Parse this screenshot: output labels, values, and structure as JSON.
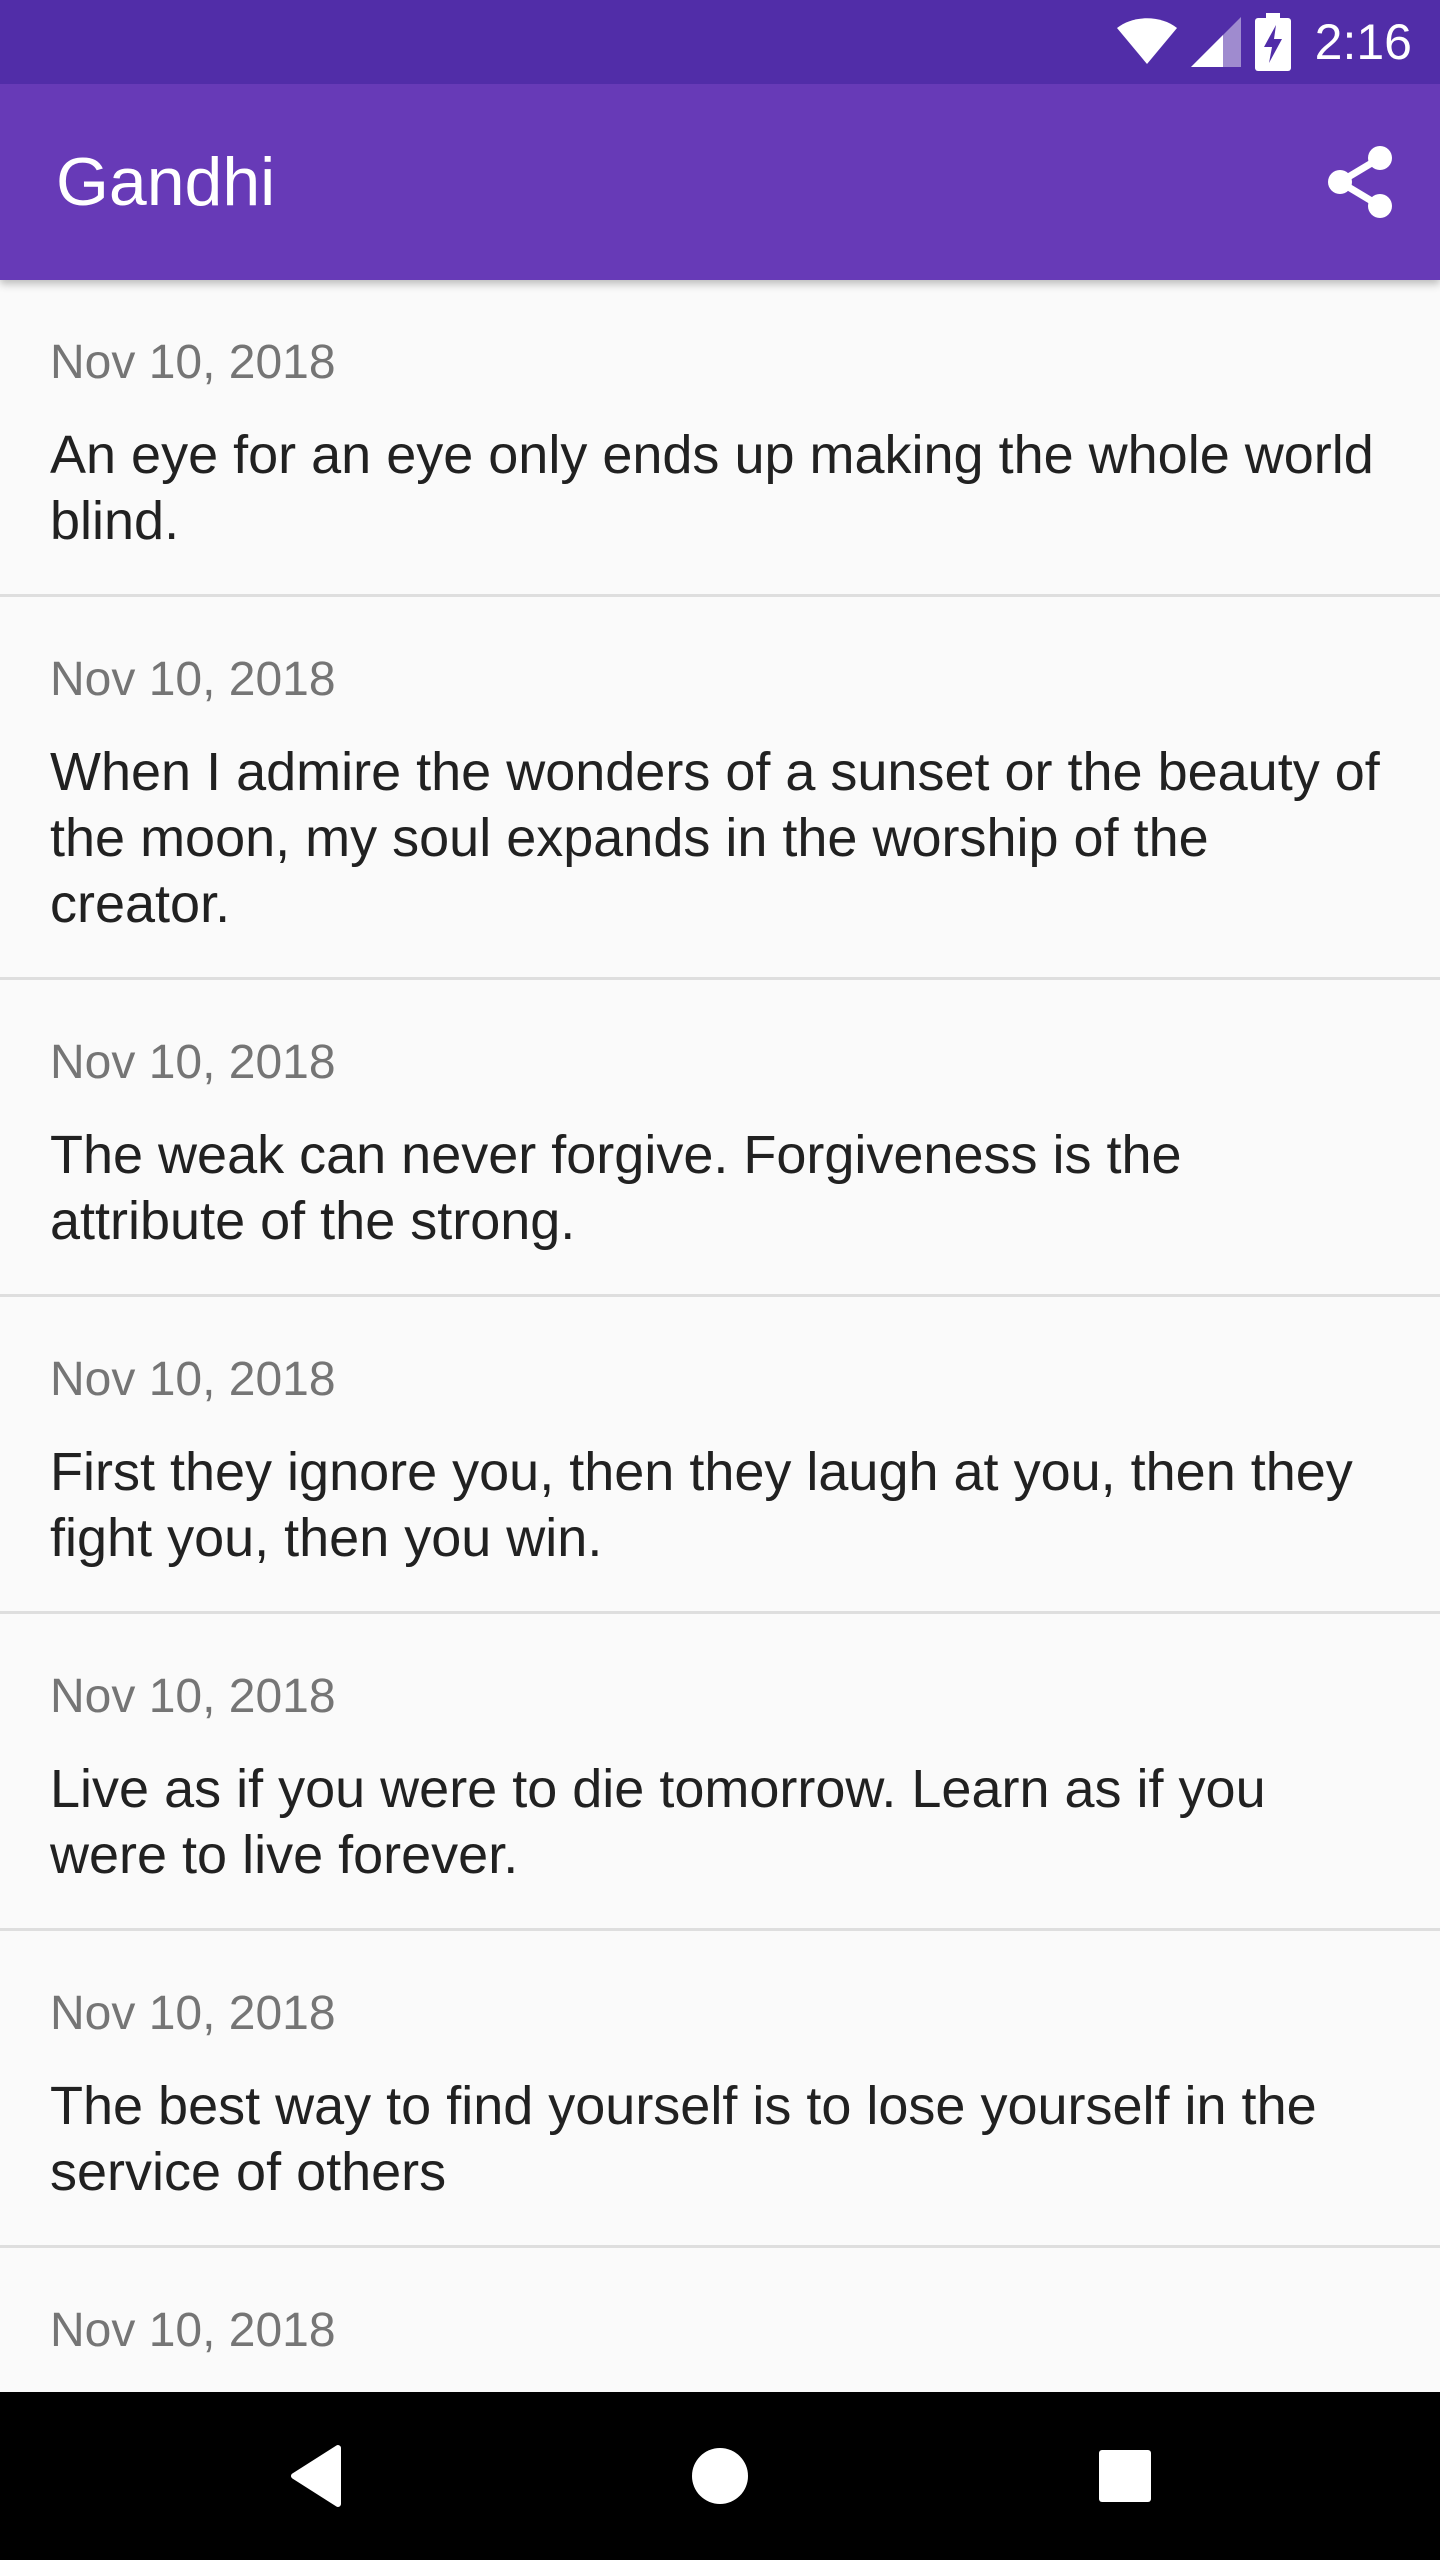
{
  "status_bar": {
    "time": "2:16",
    "icons": [
      "wifi-icon",
      "cell-signal-icon",
      "battery-charging-icon"
    ]
  },
  "app_bar": {
    "title": "Gandhi",
    "action_icon": "share-icon"
  },
  "quotes": [
    {
      "date": "Nov 10, 2018",
      "text": "An eye for an eye only ends up making the whole world blind."
    },
    {
      "date": "Nov 10, 2018",
      "text": "When I admire the wonders of a sunset or the beauty of the moon, my soul expands in the worship of the creator."
    },
    {
      "date": "Nov 10, 2018",
      "text": "The weak can never forgive. Forgiveness is the attribute of the strong."
    },
    {
      "date": "Nov 10, 2018",
      "text": "First they ignore you, then they laugh at you, then they fight you, then you win."
    },
    {
      "date": "Nov 10, 2018",
      "text": "Live as if you were to die tomorrow. Learn as if you were to live forever."
    },
    {
      "date": "Nov 10, 2018",
      "text": "The best way to find yourself is to lose yourself in the service of others"
    },
    {
      "date": "Nov 10, 2018",
      "text": ""
    }
  ],
  "nav_bar": {
    "icons": [
      "back-icon",
      "home-icon",
      "recents-icon"
    ]
  },
  "colors": {
    "status_bar": "#512da8",
    "app_bar": "#673ab7",
    "background": "#fafafa",
    "divider": "#dedede",
    "date_text": "#757575",
    "quote_text": "#212121"
  }
}
